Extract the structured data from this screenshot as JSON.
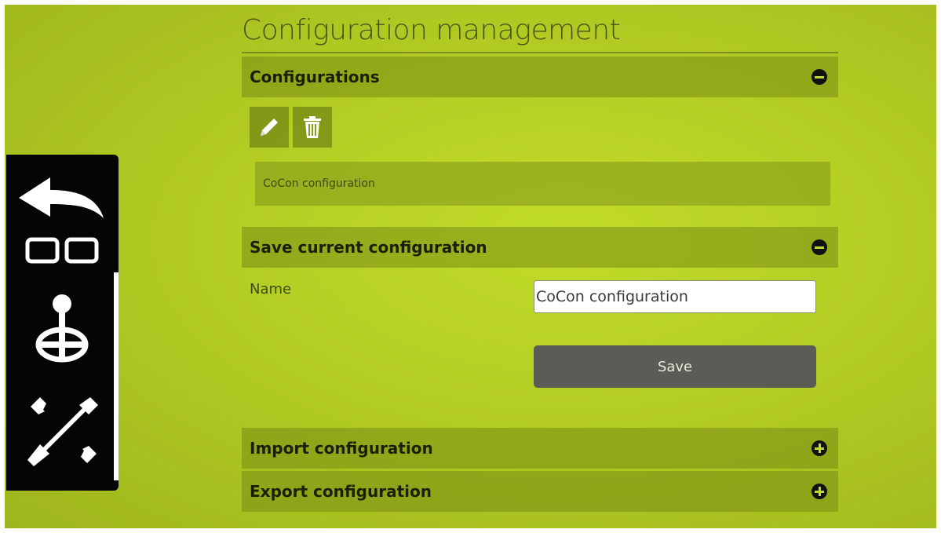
{
  "page": {
    "title": "Configuration management"
  },
  "sidebar": {
    "items": [
      {
        "icon": "back-arrow-icon"
      },
      {
        "icon": "layout-icon"
      },
      {
        "icon": "joystick-icon"
      },
      {
        "icon": "tools-icon"
      }
    ]
  },
  "sections": {
    "configurations": {
      "label": "Configurations",
      "state": "collapse"
    },
    "save_current": {
      "label": "Save current configuration",
      "state": "collapse"
    },
    "import": {
      "label": "Import configuration",
      "state": "expand"
    },
    "export": {
      "label": "Export configuration",
      "state": "expand"
    }
  },
  "configurations": {
    "toolbar": {
      "edit_icon": "pencil-icon",
      "delete_icon": "trash-icon"
    },
    "items": [
      "CoCon configuration"
    ]
  },
  "save_form": {
    "name_label": "Name",
    "name_value": "CoCon configuration",
    "save_label": "Save"
  },
  "colors": {
    "background": "#b8d125",
    "sidebar": "#050505",
    "button": "#5c5c56"
  }
}
